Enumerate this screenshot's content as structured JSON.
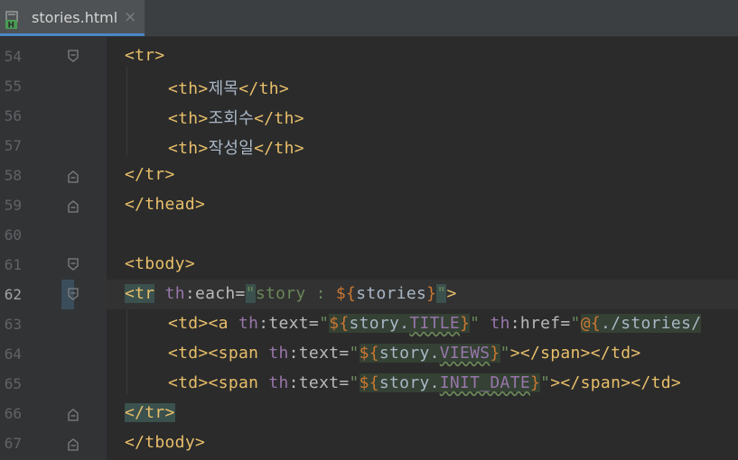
{
  "tab": {
    "label": "stories.html",
    "close": "×",
    "file_icon_letter": "H"
  },
  "lines": [
    {
      "number": "54"
    },
    {
      "number": "55",
      "text": "제목"
    },
    {
      "number": "56",
      "text": "조회수"
    },
    {
      "number": "57",
      "text": "작성일"
    },
    {
      "number": "58"
    },
    {
      "number": "59"
    },
    {
      "number": "60"
    },
    {
      "number": "61"
    },
    {
      "number": "62"
    },
    {
      "number": "63"
    },
    {
      "number": "64"
    },
    {
      "number": "65"
    },
    {
      "number": "66"
    },
    {
      "number": "67"
    }
  ],
  "code": {
    "tr_open": "<tr>",
    "th_open": "<th>",
    "th_close": "</th>",
    "tr_close": "</tr>",
    "thead_close": "</thead>",
    "tbody_open": "<tbody>",
    "tbody_close": "</tbody>",
    "tr_tag_start": "<tr",
    "th_ns": "th",
    "each_attr": ":each=",
    "each_value_open": "\"",
    "each_value_story": "story : ",
    "each_expr_open": "${",
    "each_expr_var": "stories",
    "each_expr_close": "}",
    "each_value_close": "\"",
    "tag_end": ">",
    "td_a": "<td><a ",
    "text_attr": ":text=",
    "q": "\"",
    "expr_open": "${",
    "story_dot": "story.",
    "title_field": "TITLE",
    "expr_close": "}",
    "href_attr": ":href=",
    "link_open": "@{",
    "link_path": "./stories/",
    "td_span": "<td><span ",
    "views_field": "VIEWS",
    "init_date_field": "INIT_DATE",
    "span_td_close": "></span></td>"
  },
  "colors": {
    "background": "#2b2b2b",
    "gutter": "#313335",
    "tag": "#e8bf6a",
    "string": "#6a8759",
    "keyword": "#cc7832",
    "namespace": "#9876aa"
  }
}
